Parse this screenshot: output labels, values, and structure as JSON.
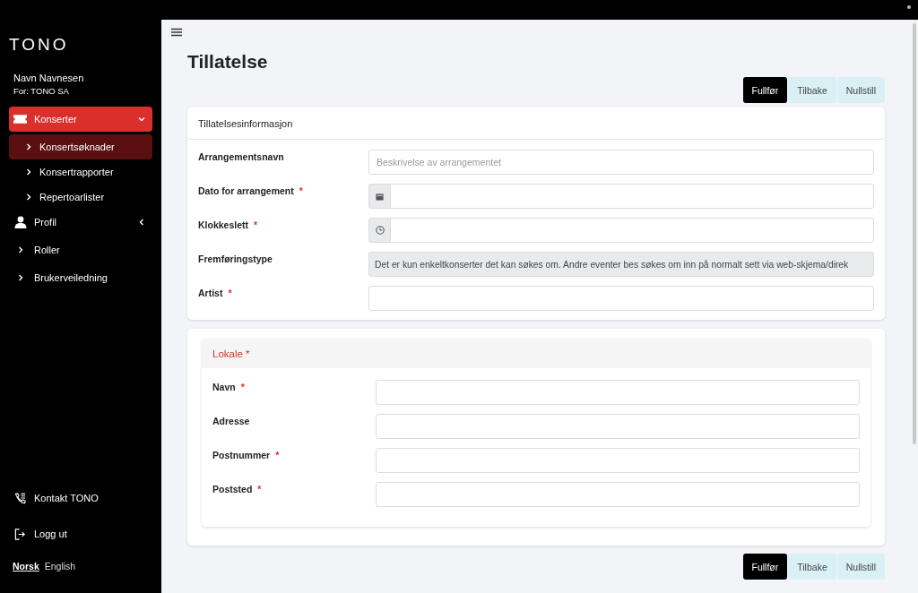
{
  "sidebar": {
    "logo": "TONO",
    "user": {
      "name": "Navn Navnesen",
      "org": "For: TONO SA"
    },
    "nav": [
      {
        "label": "Konserter",
        "kind": "ticket",
        "selected": true,
        "expanded": true,
        "children": [
          {
            "label": "Konsertsøknader",
            "selected": true
          },
          {
            "label": "Konsertrapporter",
            "selected": false
          },
          {
            "label": "Repertoarlister",
            "selected": false
          }
        ]
      },
      {
        "label": "Profil",
        "kind": "person",
        "selected": false,
        "expanded": false
      },
      {
        "label": "Roller",
        "kind": "chevron",
        "selected": false
      },
      {
        "label": "Brukerveiledning",
        "kind": "chevron",
        "selected": false
      }
    ],
    "footer": [
      {
        "label": "Kontakt TONO",
        "kind": "phone"
      },
      {
        "label": "Logg ut",
        "kind": "logout"
      }
    ],
    "languages": [
      {
        "label": "Norsk",
        "selected": true
      },
      {
        "label": "English",
        "selected": false
      }
    ]
  },
  "page": {
    "title": "Tillatelse",
    "top_buttons": [
      {
        "label": "Fullfør",
        "kind": "primary"
      },
      {
        "label": "Tilbake",
        "kind": "secondary"
      },
      {
        "label": "Nullstill",
        "kind": "secondary"
      }
    ],
    "info_card": {
      "title": "Tillatelsesinformasjon",
      "fields": [
        {
          "label": "Arrangementsnavn",
          "kind": "text",
          "placeholder": "Beskrivelse av arrangementet"
        },
        {
          "label": "Dato for arrangement",
          "required_mark": "*",
          "kind": "date"
        },
        {
          "label": "Klokkeslett",
          "required_mark": "*",
          "kind": "time"
        },
        {
          "label": "Fremføringstype",
          "kind": "readonly",
          "value": "Det er kun enkeltkonserter det kan søkes om. Andre eventer bes søkes om inn på normalt sett via web-skjema/direk"
        },
        {
          "label": "Artist",
          "required_mark": "*",
          "kind": "text"
        }
      ]
    },
    "venue_card": {
      "title": "Lokale *",
      "fields": [
        {
          "label": "Navn",
          "required_mark": "*",
          "kind": "text"
        },
        {
          "label": "Adresse",
          "kind": "text"
        },
        {
          "label": "Postnummer",
          "required_mark": "*",
          "kind": "text"
        },
        {
          "label": "Poststed",
          "required_mark": "*",
          "kind": "text"
        }
      ]
    },
    "bottom_buttons": [
      {
        "label": "Fullfør",
        "kind": "primary"
      },
      {
        "label": "Tilbake",
        "kind": "secondary"
      },
      {
        "label": "Nullstill",
        "kind": "secondary"
      }
    ]
  }
}
